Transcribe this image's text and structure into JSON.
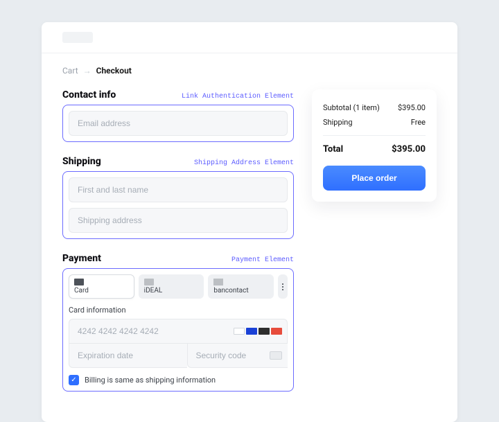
{
  "breadcrumb": {
    "cart": "Cart",
    "current": "Checkout"
  },
  "contact": {
    "title": "Contact info",
    "element_label": "Link Authentication Element",
    "email_placeholder": "Email address"
  },
  "shipping": {
    "title": "Shipping",
    "element_label": "Shipping Address Element",
    "name_placeholder": "First and last name",
    "address_placeholder": "Shipping address"
  },
  "payment": {
    "title": "Payment",
    "element_label": "Payment Element",
    "tabs": {
      "card": "Card",
      "ideal": "iDEAL",
      "bancontact": "bancontact"
    },
    "card_info_label": "Card information",
    "card_number_placeholder": "4242 4242 4242 4242",
    "expiration_placeholder": "Expiration date",
    "security_placeholder": "Security code",
    "billing_same_label": "Billing is same as shipping information"
  },
  "summary": {
    "subtotal_label": "Subtotal (1 item)",
    "subtotal_value": "$395.00",
    "shipping_label": "Shipping",
    "shipping_value": "Free",
    "total_label": "Total",
    "total_value": "$395.00",
    "place_order_label": "Place order"
  }
}
